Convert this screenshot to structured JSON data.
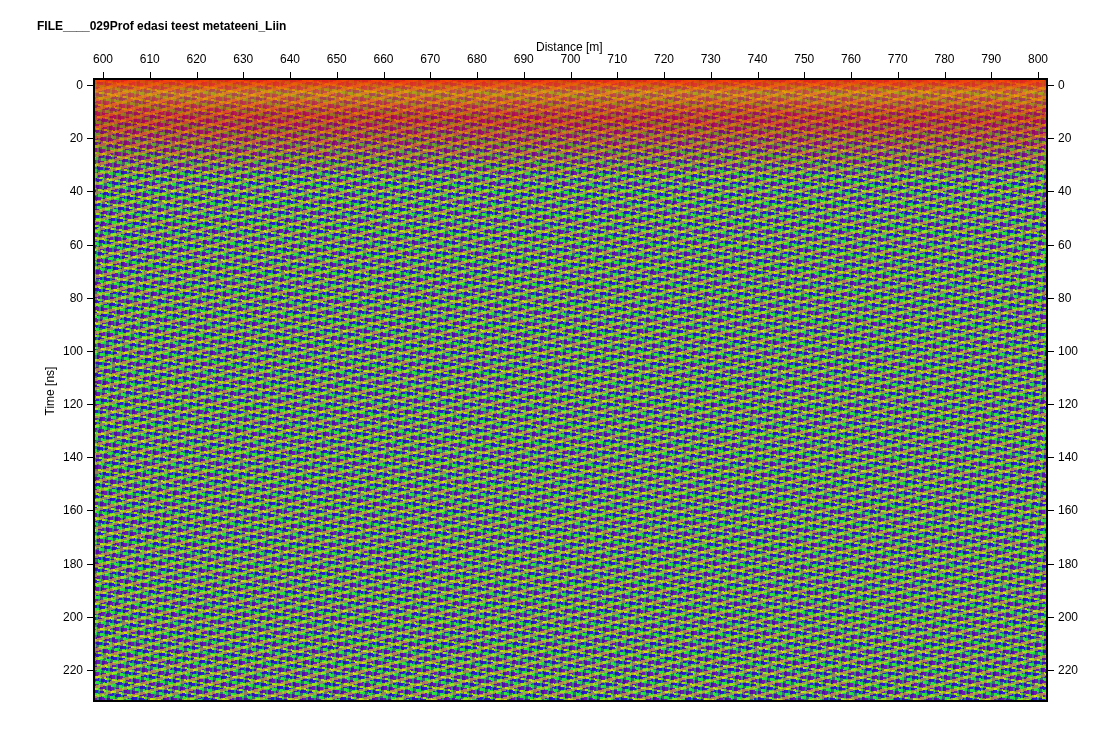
{
  "title": "FILE____029Prof edasi teest metateeni_Liin",
  "x_axis": {
    "label": "Distance [m]",
    "ticks": [
      "600",
      "610",
      "620",
      "630",
      "640",
      "650",
      "660",
      "670",
      "680",
      "690",
      "700",
      "710",
      "720",
      "730",
      "740",
      "750",
      "760",
      "770",
      "780",
      "790",
      "800"
    ]
  },
  "y_axis": {
    "label": "Time [ns]",
    "left_ticks": [
      "0",
      "20",
      "40",
      "60",
      "80",
      "100",
      "120",
      "140",
      "160",
      "180",
      "200",
      "220"
    ],
    "right_ticks": [
      "0",
      "20",
      "40",
      "60",
      "80",
      "100",
      "120",
      "140",
      "160",
      "180",
      "200",
      "220"
    ]
  }
}
